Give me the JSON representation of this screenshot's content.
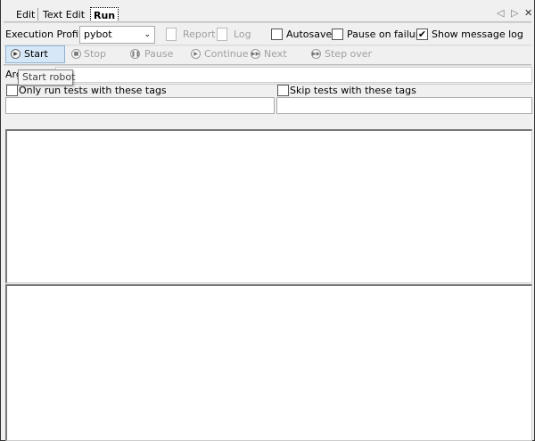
{
  "tabs": [
    {
      "label": "Edit"
    },
    {
      "label": "Text Edit"
    },
    {
      "label": "Run"
    }
  ],
  "window_controls": {
    "prev": "◁",
    "next": "▷",
    "close": "✕"
  },
  "profile": {
    "label": "Execution Profile:",
    "value": "pybot"
  },
  "report_label": "Report",
  "log_label": "Log",
  "autosave": {
    "label": "Autosave",
    "checked": false
  },
  "pause_on_failure": {
    "label": "Pause on failure",
    "checked": false
  },
  "show_message_log": {
    "label": "Show message log",
    "checked": true,
    "mark": "✔"
  },
  "buttons": {
    "start": "Start",
    "stop": "Stop",
    "pause": "Pause",
    "continue": "Continue",
    "next": "Next",
    "step_over": "Step over"
  },
  "arguments_label": "Arg",
  "tooltip": "Start robot",
  "include_tags": {
    "label": "Only run tests with these tags",
    "value": ""
  },
  "exclude_tags": {
    "label": "Skip tests with these tags",
    "value": ""
  }
}
